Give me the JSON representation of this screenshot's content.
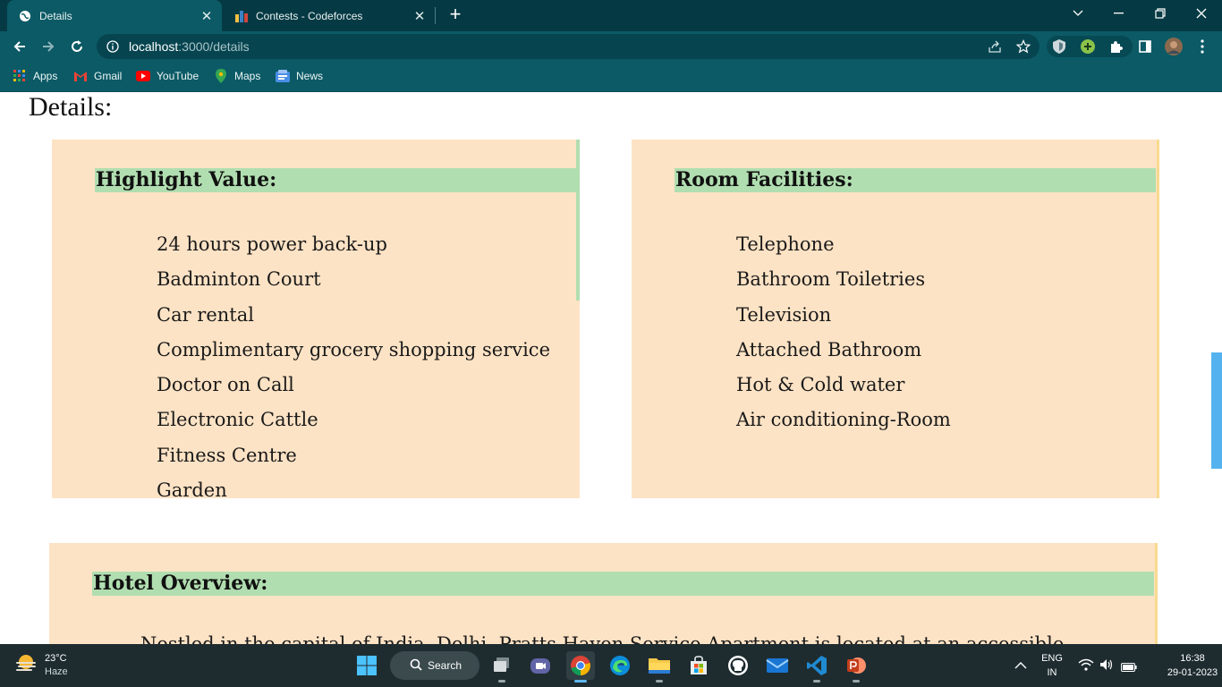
{
  "browser": {
    "tabs": [
      {
        "title": "Details",
        "active": true
      },
      {
        "title": "Contests - Codeforces",
        "active": false
      }
    ],
    "url_host": "localhost",
    "url_path": ":3000/details",
    "bookmarks": [
      "Apps",
      "Gmail",
      "YouTube",
      "Maps",
      "News"
    ]
  },
  "page": {
    "title": "Details:",
    "highlight": {
      "heading": "Highlight Value:",
      "items": [
        "24 hours power back-up",
        "Badminton Court",
        "Car rental",
        "Complimentary grocery shopping service",
        "Doctor on Call",
        "Electronic Cattle",
        "Fitness Centre",
        "Garden"
      ]
    },
    "facilities": {
      "heading": "Room Facilities:",
      "items": [
        "Telephone",
        "Bathroom Toiletries",
        "Television",
        "Attached Bathroom",
        "Hot & Cold water",
        "Air conditioning-Room"
      ]
    },
    "overview": {
      "heading": "Hotel Overview:",
      "text_partial": "Nestled in the capital of India, Delhi, Pratts Haven Service Apartment is located at an accessible"
    },
    "colors": {
      "card_bg": "#fde3c5",
      "heading_bg": "#b1deb0",
      "browser_frame": "#0b5a66"
    }
  },
  "taskbar": {
    "weather_temp": "23°C",
    "weather_desc": "Haze",
    "search_label": "Search",
    "lang": "ENG",
    "region": "IN",
    "time": "16:38",
    "date": "29-01-2023",
    "apps": [
      "windows-start",
      "search",
      "file-explorer-gallery",
      "teams-meet",
      "chrome",
      "edge",
      "file-explorer",
      "microsoft-store",
      "github-desktop",
      "mail",
      "vscode",
      "powerpoint"
    ]
  }
}
